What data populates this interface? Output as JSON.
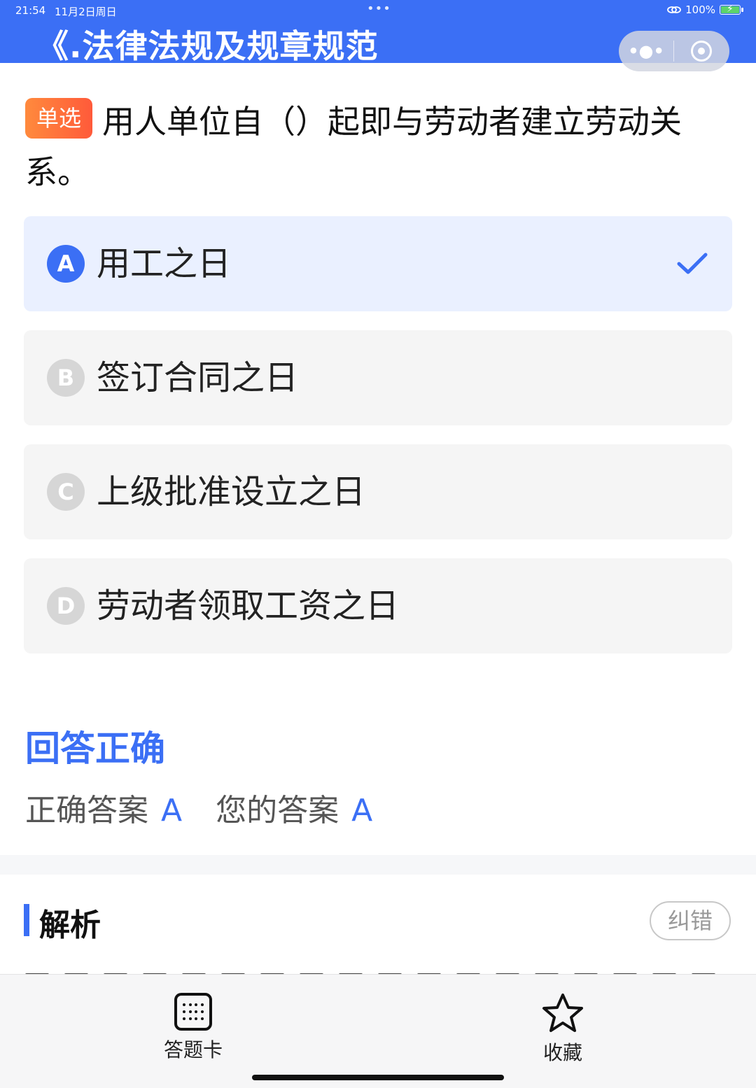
{
  "status_bar": {
    "time": "21:54",
    "date": "11月2日周日",
    "battery": "100%"
  },
  "app": {
    "title": "《.法律法规及规章规范",
    "more_icon": "•••",
    "target_icon": "record-icon"
  },
  "question": {
    "type_tag": "单选",
    "text": "用人单位自（）起即与劳动者建立劳动关系。"
  },
  "options": [
    {
      "letter": "A",
      "text": "用工之日",
      "selected": true
    },
    {
      "letter": "B",
      "text": "签订合同之日",
      "selected": false
    },
    {
      "letter": "C",
      "text": "上级批准设立之日",
      "selected": false
    },
    {
      "letter": "D",
      "text": "劳动者领取工资之日",
      "selected": false
    }
  ],
  "result": {
    "title": "回答正确",
    "correct_label": "正确答案",
    "correct_value": "A",
    "your_label": "您的答案",
    "your_value": "A"
  },
  "analysis": {
    "title": "解析",
    "report_label": "纠错"
  },
  "bottom_bar": {
    "card_label": "答题卡",
    "favorite_label": "收藏"
  },
  "colors": {
    "accent": "#3b6ff5",
    "tag_orange": "#ff6a3a",
    "selected_bg": "#eaf0ff",
    "option_bg": "#f5f5f5"
  }
}
